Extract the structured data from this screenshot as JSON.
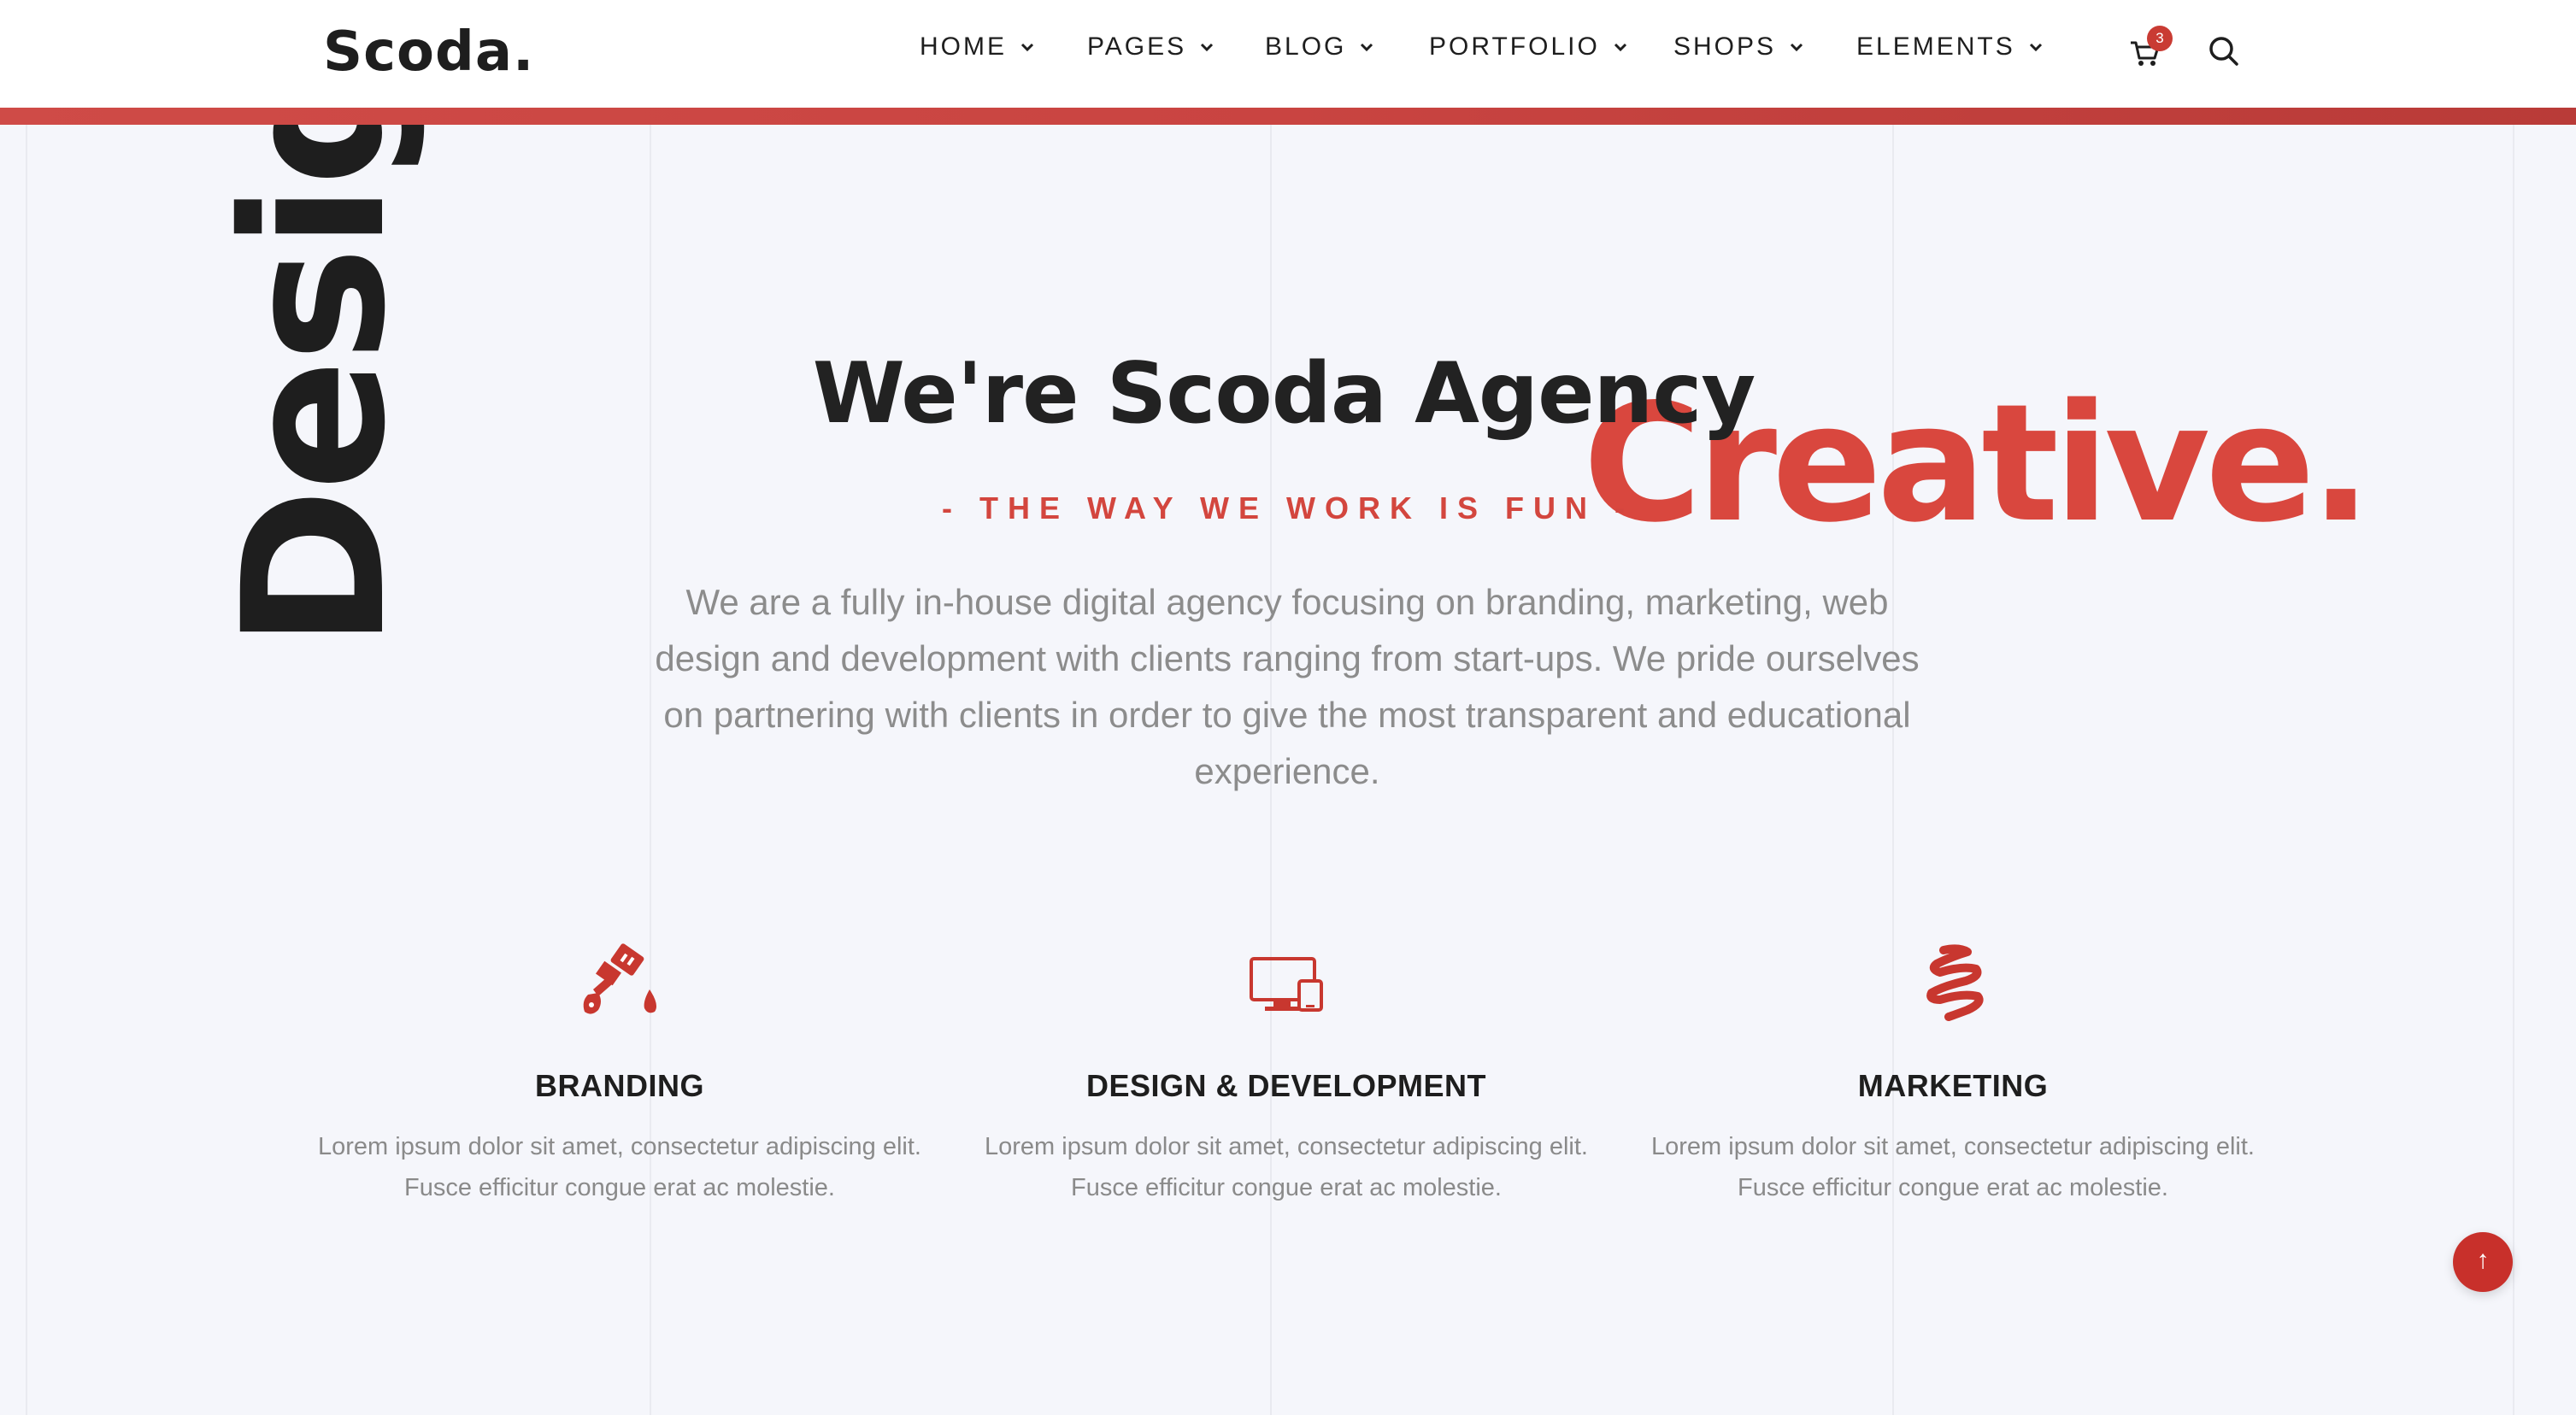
{
  "brand": {
    "logo": "Scoda.",
    "accent": "#d9473e"
  },
  "nav": {
    "items": [
      {
        "label": "HOME"
      },
      {
        "label": "PAGES"
      },
      {
        "label": "BLOG"
      },
      {
        "label": "PORTFOLIO"
      },
      {
        "label": "SHOPS"
      },
      {
        "label": "ELEMENTS"
      }
    ],
    "cart_count": "3",
    "icons": {
      "cart": "cart-icon",
      "search": "search-icon",
      "dropdown": "chevron-down-icon"
    }
  },
  "hero": {
    "side_word": "Design",
    "title": "We're Scoda Agency",
    "overlay_word": "Creative.",
    "tagline": "- THE WAY WE WORK IS FUN -",
    "description": "We are a fully in-house digital agency focusing on branding, marketing, web design and development with clients ranging from start-ups. We pride ourselves on partnering with clients in order to give the most transparent and educational experience."
  },
  "services": [
    {
      "icon": "paint-brush-icon",
      "title": "BRANDING",
      "text": "Lorem ipsum dolor sit amet, consectetur adipiscing elit. Fusce efficitur congue erat ac molestie."
    },
    {
      "icon": "devices-icon",
      "title": "DESIGN & DEVELOPMENT",
      "text": "Lorem ipsum dolor sit amet, consectetur adipiscing elit. Fusce efficitur congue erat ac molestie."
    },
    {
      "icon": "squiggle-icon",
      "title": "MARKETING",
      "text": "Lorem ipsum dolor sit amet, consectetur adipiscing elit. Fusce efficitur congue erat ac molestie."
    }
  ],
  "back_to_top": {
    "icon": "arrow-up-icon",
    "label": "↑"
  }
}
